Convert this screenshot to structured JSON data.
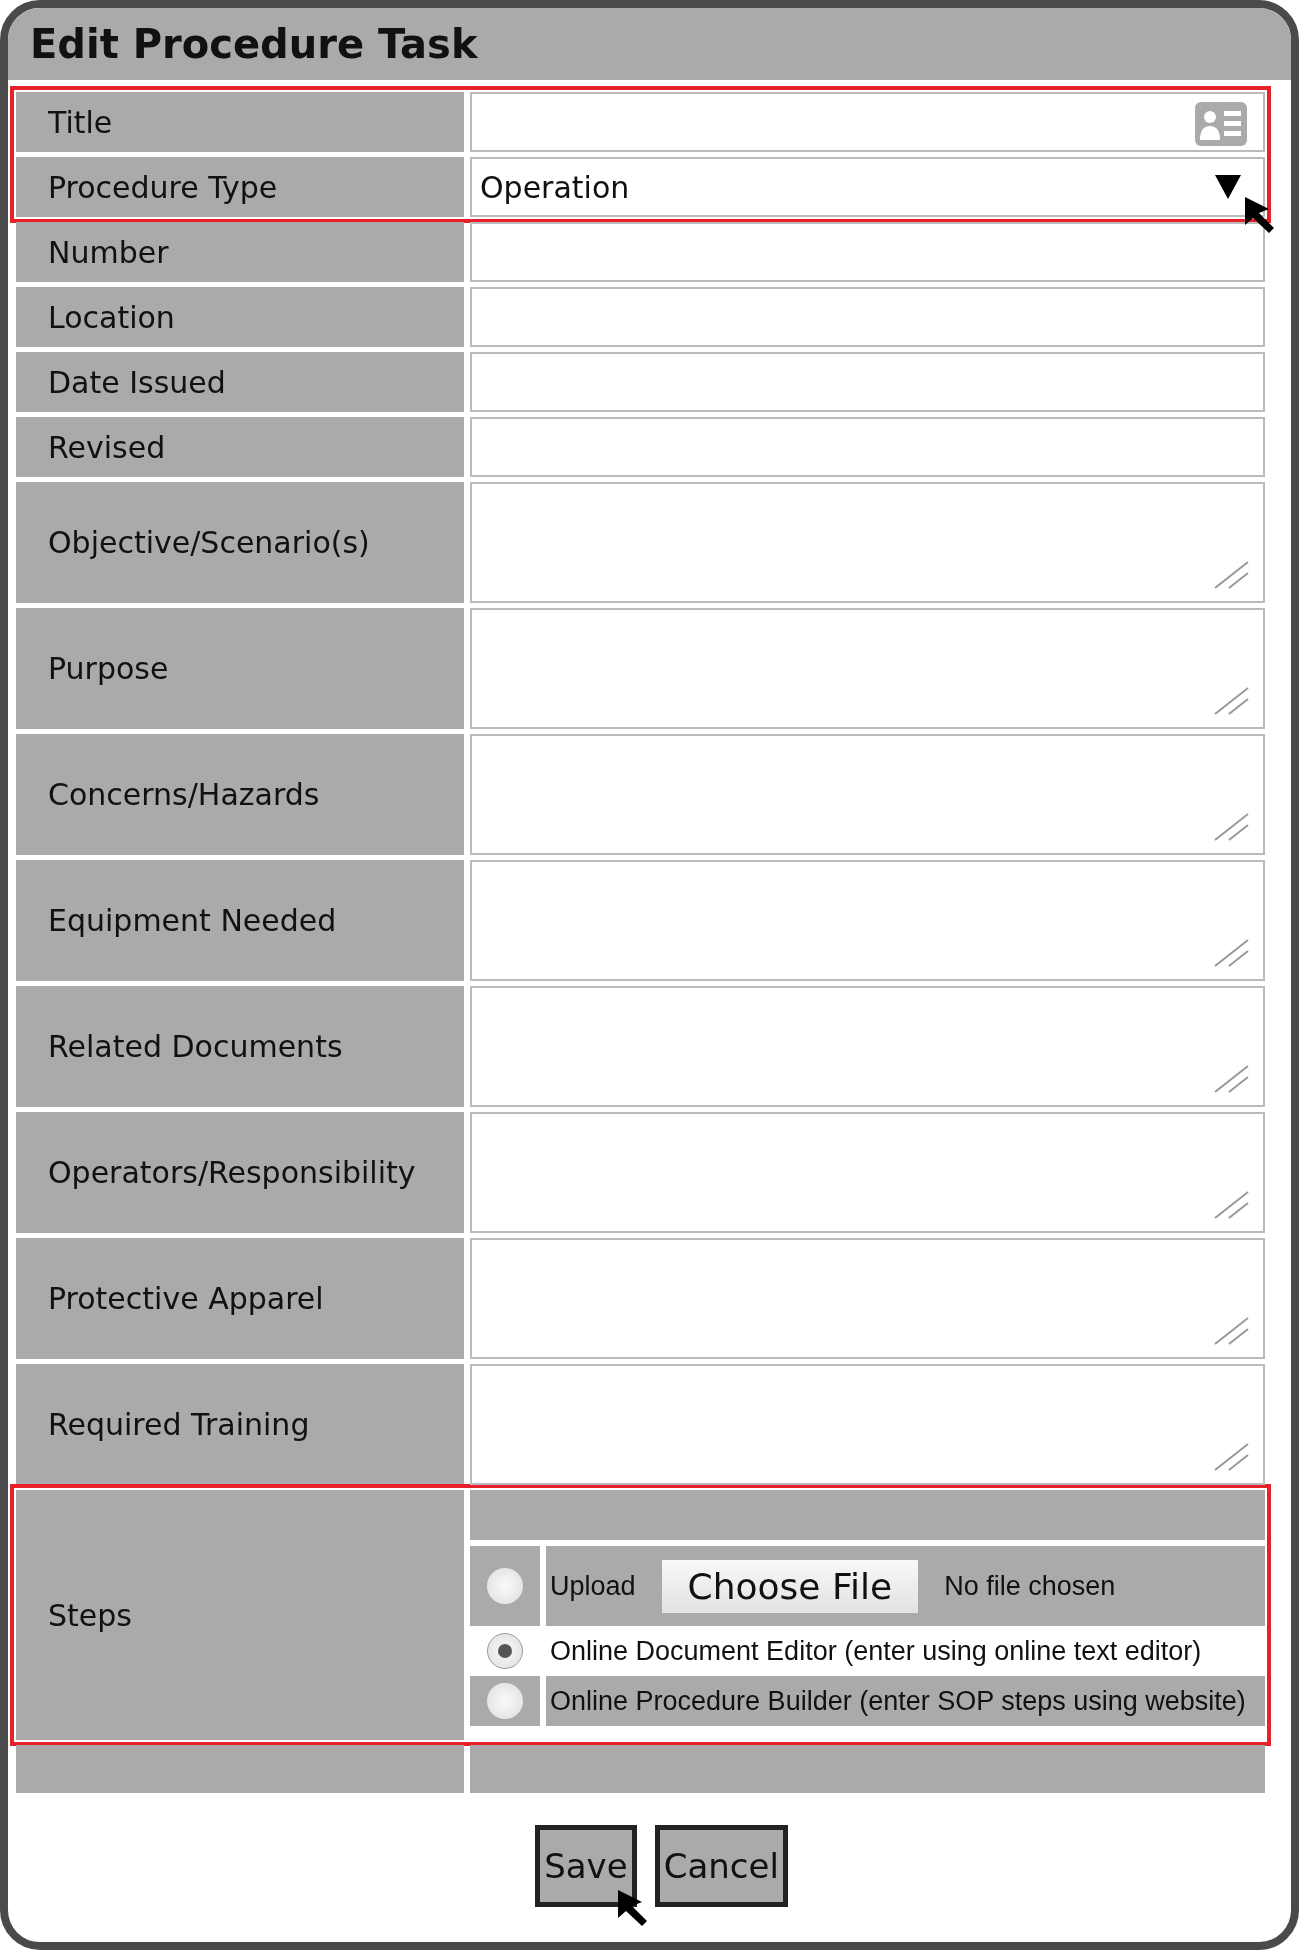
{
  "window": {
    "title": "Edit Procedure Task"
  },
  "sections": [
    {
      "highlighted": true,
      "fields": [
        {
          "kind": "text",
          "label": "Title",
          "lookup": true
        },
        {
          "kind": "select",
          "label": "Procedure Type",
          "value": "Operation",
          "cursor": true
        }
      ]
    },
    {
      "highlighted": false,
      "fields": [
        {
          "kind": "text",
          "label": "Number"
        },
        {
          "kind": "text",
          "label": "Location"
        },
        {
          "kind": "text",
          "label": "Date Issued"
        },
        {
          "kind": "text",
          "label": "Revised"
        },
        {
          "kind": "textarea",
          "label": "Objective/Scenario(s)"
        },
        {
          "kind": "textarea",
          "label": "Purpose"
        },
        {
          "kind": "textarea",
          "label": "Concerns/Hazards"
        },
        {
          "kind": "textarea",
          "label": "Equipment Needed"
        },
        {
          "kind": "textarea",
          "label": "Related Documents"
        },
        {
          "kind": "textarea",
          "label": "Operators/Responsibility"
        },
        {
          "kind": "textarea",
          "label": "Protective Apparel"
        },
        {
          "kind": "textarea",
          "label": "Required Training"
        }
      ]
    },
    {
      "highlighted": true,
      "fields": [
        {
          "kind": "steps",
          "label": "Steps",
          "options": [
            {
              "kind": "upload",
              "label": "Upload",
              "button": "Choose File",
              "status": "No file chosen",
              "selected": false
            },
            {
              "kind": "plain",
              "label": "Online Document Editor (enter using online text editor)",
              "selected": true
            },
            {
              "kind": "plain",
              "label": "Online Procedure Builder (enter SOP steps using website)",
              "selected": false
            }
          ]
        }
      ]
    }
  ],
  "buttons": [
    {
      "label": "Save",
      "cursor": true
    },
    {
      "label": "Cancel",
      "cursor": false
    }
  ]
}
